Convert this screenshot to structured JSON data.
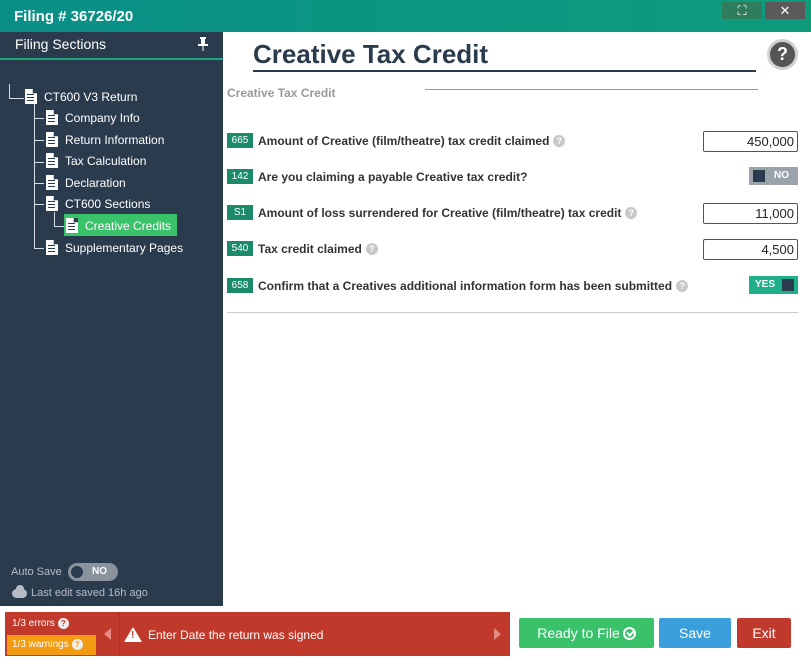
{
  "window": {
    "title": "Filing # 36726/20",
    "maximize_icon": "expand-icon",
    "close_icon": "close-icon"
  },
  "sidebar": {
    "header": "Filing Sections",
    "collapse_label": "»",
    "tree": [
      {
        "label": "CT600 V3 Return"
      },
      {
        "label": "Company Info"
      },
      {
        "label": "Return Information"
      },
      {
        "label": "Tax Calculation"
      },
      {
        "label": "Declaration"
      },
      {
        "label": "CT600 Sections"
      },
      {
        "label": "Creative Credits",
        "selected": true
      },
      {
        "label": "Supplementary Pages"
      }
    ],
    "autosave_label": "Auto Save",
    "autosave_value": "NO",
    "last_edit": "Last edit saved 16h ago"
  },
  "main": {
    "title": "Creative Tax Credit",
    "help_glyph": "?",
    "section_title": "Creative Tax Credit",
    "rows": [
      {
        "code": "665",
        "label": "Amount of Creative (film/theatre) tax credit claimed",
        "value": "450,000",
        "type": "input"
      },
      {
        "code": "142",
        "label": "Are you claiming a payable Creative tax credit?",
        "value": "NO",
        "type": "switch"
      },
      {
        "code": "S1",
        "label": "Amount of loss surrendered for Creative (film/theatre) tax credit",
        "value": "11,000",
        "type": "input"
      },
      {
        "code": "540",
        "label": "Tax credit claimed",
        "value": "4,500",
        "type": "input"
      },
      {
        "code": "658",
        "label": "Confirm that a Creatives additional information form has been submitted",
        "value": "YES",
        "type": "switch"
      }
    ]
  },
  "footer": {
    "errors": "1/3 errors",
    "warnings": "1/3 warnings",
    "message": "Enter Date the return was signed",
    "ready_label": "Ready to File",
    "save_label": "Save",
    "exit_label": "Exit"
  },
  "colors": {
    "accent": "#1fa67a",
    "sidebar": "#2b3b4e",
    "error": "#c0392b",
    "warning": "#f39c12",
    "save": "#3a9fdc"
  }
}
